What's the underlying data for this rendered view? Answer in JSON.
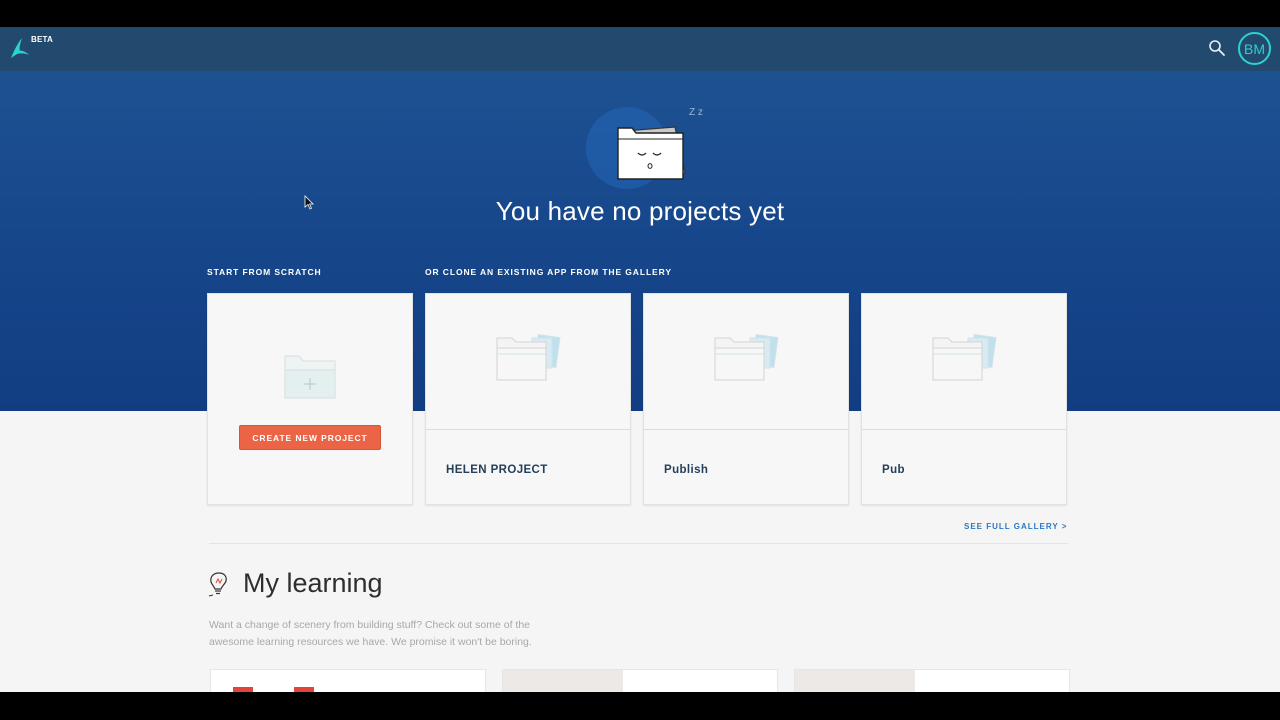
{
  "header": {
    "beta_label": "BETA",
    "avatar_initials": "BM"
  },
  "hero": {
    "title": "You have no projects yet",
    "illustration_zz": "Z z"
  },
  "sections": {
    "scratch_label": "START FROM SCRATCH",
    "gallery_label": "OR CLONE AN EXISTING APP FROM THE GALLERY"
  },
  "scratch_card": {
    "button_label": "CREATE NEW PROJECT"
  },
  "gallery_cards": [
    {
      "name": "HELEN PROJECT"
    },
    {
      "name": "Publish"
    },
    {
      "name": "Pub"
    }
  ],
  "gallery_link": "SEE FULL GALLERY >",
  "learning": {
    "title": "My learning",
    "description": "Want a change of scenery from building stuff? Check out some of the awesome learning resources we have. We promise it won't be boring."
  },
  "colors": {
    "accent_teal": "#2ad3cf",
    "hero_blue": "#1a4d8f",
    "create_button": "#ec6446",
    "link_blue": "#2a77c5"
  }
}
